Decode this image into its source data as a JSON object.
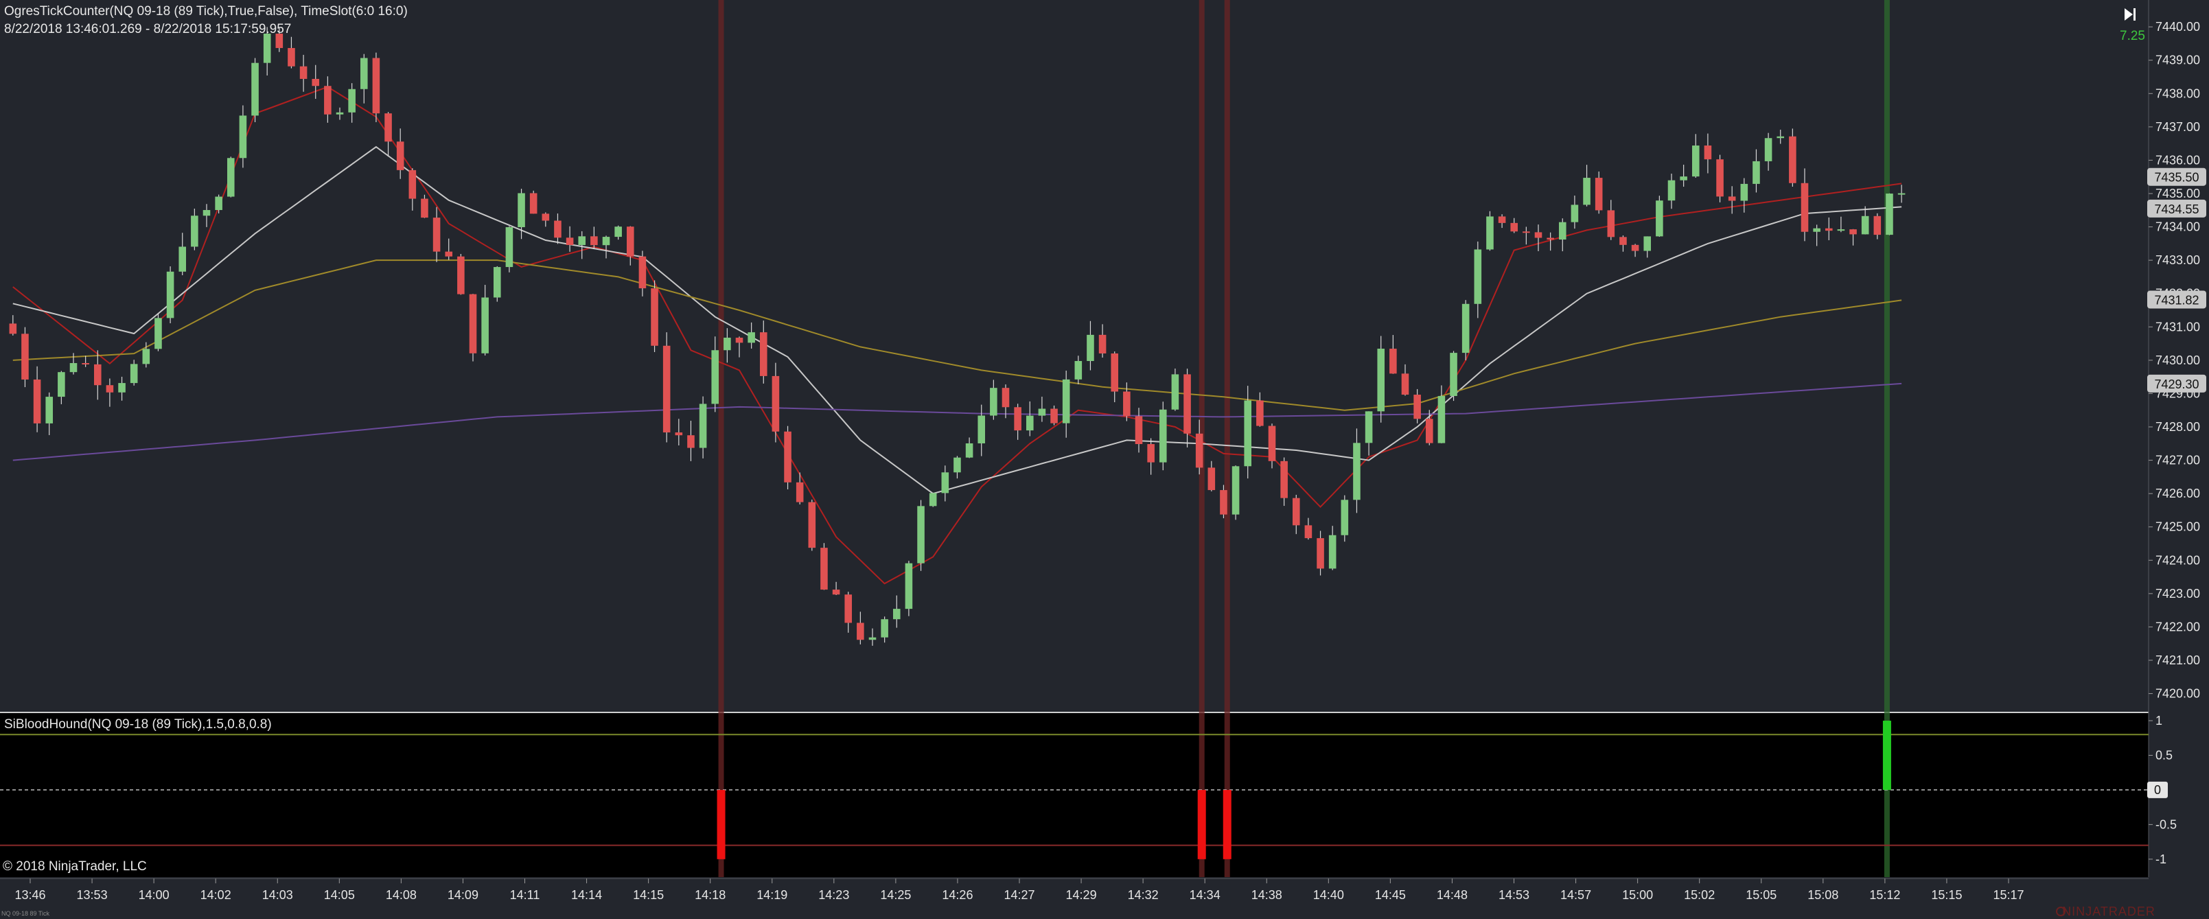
{
  "window": {
    "indicator_title": "OgresTickCounter(NQ 09-18 (89 Tick),True,False), TimeSlot(6:0    16:0)",
    "date_range": "8/22/2018 13:46:01.269 - 8/22/2018 15:17:59.957",
    "tick_counter_value": "7.25",
    "lower_panel_title": "SiBloodHound(NQ 09-18 (89 Tick),1.5,0.8,0.8)",
    "copyright": "© 2018 NinjaTrader, LLC",
    "brand": "NINJATRADER",
    "instrument_small": "NQ 09-18 89 Tick"
  },
  "colors": {
    "background": "#23262d",
    "lower_panel_bg": "#000000",
    "up_candle": "#7fc97f",
    "down_candle": "#e05252",
    "sma_red": "#b02020",
    "sma_white": "#c8c8c8",
    "sma_gold": "#a08a2a",
    "sma_purple": "#6a4a9a",
    "signal_up": "#22cc22",
    "signal_down": "#ee1111"
  },
  "chart_data": {
    "type": "candlestick",
    "price_axis_ticks": [
      "7440.00",
      "7439.00",
      "7438.00",
      "7437.00",
      "7436.00",
      "7435.00",
      "7434.00",
      "7433.00",
      "7432.00",
      "7431.00",
      "7430.00",
      "7429.00",
      "7428.00",
      "7427.00",
      "7426.00",
      "7425.00",
      "7424.00",
      "7423.00",
      "7422.00",
      "7421.00",
      "7420.00"
    ],
    "price_range": [
      7419.6,
      7440.6
    ],
    "price_labels": [
      {
        "text": "7435.50",
        "value": 7435.5,
        "bg": "#c8c8c8"
      },
      {
        "text": "7434.55",
        "value": 7434.55,
        "bg": "#c8c8c8"
      },
      {
        "text": "7431.82",
        "value": 7431.82,
        "bg": "#c8c8c8"
      },
      {
        "text": "7429.30",
        "value": 7429.3,
        "bg": "#c8c8c8"
      }
    ],
    "time_axis_labels": [
      "13:46",
      "13:53",
      "14:00",
      "14:02",
      "14:03",
      "14:05",
      "14:08",
      "14:09",
      "14:11",
      "14:14",
      "14:15",
      "14:18",
      "14:19",
      "14:23",
      "14:25",
      "14:26",
      "14:27",
      "14:29",
      "14:32",
      "14:34",
      "14:38",
      "14:40",
      "14:45",
      "14:48",
      "14:53",
      "14:57",
      "15:00",
      "15:02",
      "15:05",
      "15:08",
      "15:12",
      "15:15",
      "15:17"
    ],
    "bar_count": 165,
    "close_anchors": [
      [
        0,
        7430.8
      ],
      [
        2,
        7428.4
      ],
      [
        5,
        7430.1
      ],
      [
        8,
        7429.3
      ],
      [
        11,
        7430.0
      ],
      [
        14,
        7433.7
      ],
      [
        17,
        7434.8
      ],
      [
        19,
        7437.4
      ],
      [
        21,
        7439.8
      ],
      [
        24,
        7438.6
      ],
      [
        26,
        7437.2
      ],
      [
        29,
        7438.9
      ],
      [
        31,
        7436.6
      ],
      [
        34,
        7434.0
      ],
      [
        36,
        7433.0
      ],
      [
        38,
        7430.5
      ],
      [
        40,
        7432.8
      ],
      [
        42,
        7435.2
      ],
      [
        44,
        7434.1
      ],
      [
        46,
        7433.8
      ],
      [
        48,
        7433.3
      ],
      [
        50,
        7434.3
      ],
      [
        52,
        7432.2
      ],
      [
        54,
        7428.1
      ],
      [
        56,
        7427.4
      ],
      [
        58,
        7430.1
      ],
      [
        61,
        7430.8
      ],
      [
        63,
        7427.9
      ],
      [
        65,
        7425.4
      ],
      [
        67,
        7423.1
      ],
      [
        69,
        7422.2
      ],
      [
        71,
        7421.4
      ],
      [
        73,
        7422.6
      ],
      [
        75,
        7425.8
      ],
      [
        78,
        7426.8
      ],
      [
        81,
        7429.5
      ],
      [
        83,
        7427.9
      ],
      [
        86,
        7428.4
      ],
      [
        89,
        7431.0
      ],
      [
        92,
        7428.0
      ],
      [
        94,
        7427.2
      ],
      [
        96,
        7429.5
      ],
      [
        98,
        7426.6
      ],
      [
        100,
        7425.1
      ],
      [
        102,
        7428.9
      ],
      [
        104,
        7427.0
      ],
      [
        106,
        7425.0
      ],
      [
        108,
        7424.1
      ],
      [
        110,
        7426.1
      ],
      [
        113,
        7430.0
      ],
      [
        115,
        7429.1
      ],
      [
        117,
        7427.2
      ],
      [
        120,
        7432.0
      ],
      [
        122,
        7434.6
      ],
      [
        125,
        7433.9
      ],
      [
        127,
        7433.5
      ],
      [
        130,
        7435.5
      ],
      [
        132,
        7433.5
      ],
      [
        134,
        7433.1
      ],
      [
        137,
        7435.4
      ],
      [
        139,
        7436.3
      ],
      [
        142,
        7434.5
      ],
      [
        144,
        7436.2
      ],
      [
        146,
        7437.0
      ],
      [
        148,
        7434.2
      ],
      [
        151,
        7434.0
      ],
      [
        154,
        7434.1
      ],
      [
        156,
        7435.2
      ]
    ],
    "moving_averages": [
      {
        "color_key": "sma_red",
        "anchors": [
          [
            0,
            7432.2
          ],
          [
            8,
            7429.9
          ],
          [
            14,
            7431.8
          ],
          [
            20,
            7437.4
          ],
          [
            26,
            7438.2
          ],
          [
            30,
            7437.3
          ],
          [
            36,
            7434.1
          ],
          [
            42,
            7432.8
          ],
          [
            48,
            7433.4
          ],
          [
            52,
            7433.0
          ],
          [
            56,
            7430.3
          ],
          [
            60,
            7429.7
          ],
          [
            64,
            7427.2
          ],
          [
            68,
            7424.7
          ],
          [
            72,
            7423.3
          ],
          [
            76,
            7424.1
          ],
          [
            80,
            7426.2
          ],
          [
            84,
            7427.5
          ],
          [
            88,
            7428.5
          ],
          [
            92,
            7428.3
          ],
          [
            96,
            7428.0
          ],
          [
            100,
            7427.2
          ],
          [
            104,
            7427.1
          ],
          [
            108,
            7425.6
          ],
          [
            112,
            7427.1
          ],
          [
            116,
            7427.6
          ],
          [
            120,
            7430.0
          ],
          [
            124,
            7433.3
          ],
          [
            130,
            7433.9
          ],
          [
            136,
            7434.3
          ],
          [
            142,
            7434.6
          ],
          [
            148,
            7434.9
          ],
          [
            156,
            7435.3
          ]
        ]
      },
      {
        "color_key": "sma_white",
        "anchors": [
          [
            0,
            7431.7
          ],
          [
            10,
            7430.8
          ],
          [
            20,
            7433.8
          ],
          [
            30,
            7436.4
          ],
          [
            36,
            7434.8
          ],
          [
            44,
            7433.6
          ],
          [
            52,
            7433.1
          ],
          [
            58,
            7431.3
          ],
          [
            64,
            7430.1
          ],
          [
            70,
            7427.6
          ],
          [
            76,
            7426.0
          ],
          [
            84,
            7426.8
          ],
          [
            92,
            7427.6
          ],
          [
            98,
            7427.5
          ],
          [
            106,
            7427.3
          ],
          [
            112,
            7427.0
          ],
          [
            116,
            7428.0
          ],
          [
            122,
            7429.9
          ],
          [
            130,
            7432.0
          ],
          [
            140,
            7433.5
          ],
          [
            148,
            7434.4
          ],
          [
            156,
            7434.6
          ]
        ]
      },
      {
        "color_key": "sma_gold",
        "anchors": [
          [
            0,
            7430.0
          ],
          [
            10,
            7430.2
          ],
          [
            20,
            7432.1
          ],
          [
            30,
            7433.0
          ],
          [
            40,
            7433.0
          ],
          [
            50,
            7432.5
          ],
          [
            60,
            7431.5
          ],
          [
            70,
            7430.4
          ],
          [
            80,
            7429.7
          ],
          [
            90,
            7429.2
          ],
          [
            100,
            7428.9
          ],
          [
            110,
            7428.5
          ],
          [
            116,
            7428.7
          ],
          [
            124,
            7429.6
          ],
          [
            134,
            7430.5
          ],
          [
            146,
            7431.3
          ],
          [
            156,
            7431.8
          ]
        ]
      },
      {
        "color_key": "sma_purple",
        "anchors": [
          [
            0,
            7427.0
          ],
          [
            20,
            7427.6
          ],
          [
            40,
            7428.3
          ],
          [
            60,
            7428.6
          ],
          [
            80,
            7428.4
          ],
          [
            100,
            7428.3
          ],
          [
            120,
            7428.4
          ],
          [
            140,
            7428.9
          ],
          [
            156,
            7429.3
          ]
        ]
      }
    ],
    "signals": [
      {
        "bar": 58.5,
        "value": -1,
        "color_key": "signal_down"
      },
      {
        "bar": 98.2,
        "value": -1,
        "color_key": "signal_down"
      },
      {
        "bar": 100.3,
        "value": -1,
        "color_key": "signal_down"
      },
      {
        "bar": 154.8,
        "value": 1,
        "color_key": "signal_up"
      }
    ],
    "lower_axis_ticks": [
      {
        "text": "1",
        "value": 1
      },
      {
        "text": "0.5",
        "value": 0.5
      },
      {
        "text": "0",
        "value": 0
      },
      {
        "text": "-0.5",
        "value": -0.5
      },
      {
        "text": "-1",
        "value": -1
      }
    ],
    "lower_range": [
      -1.2,
      1.05
    ],
    "threshold_lines": [
      {
        "value": 0.8,
        "color": "#7a8a2a"
      },
      {
        "value": -0.8,
        "color": "#8a2a2a"
      }
    ]
  }
}
